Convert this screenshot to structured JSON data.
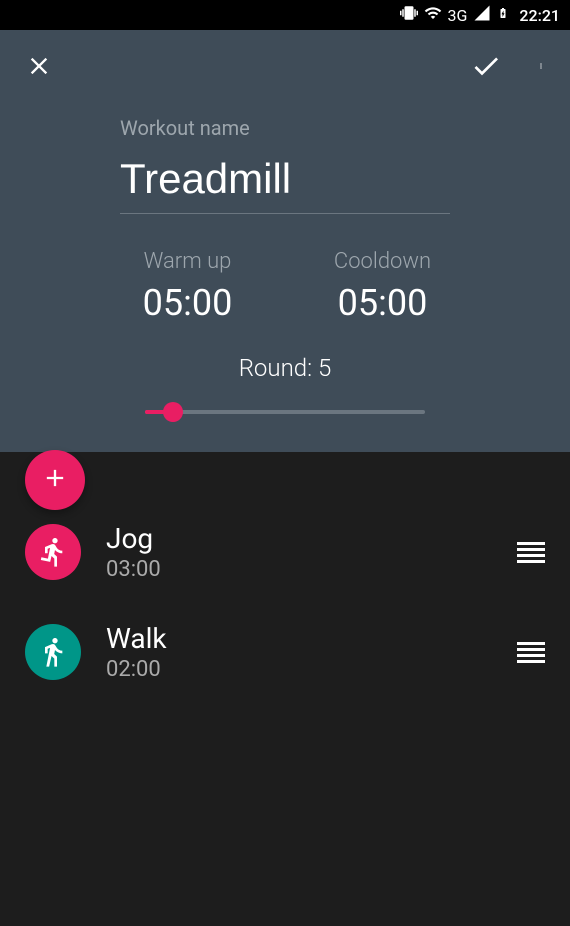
{
  "status": {
    "network": "3G",
    "time": "22:21"
  },
  "form": {
    "name_label": "Workout name",
    "name_value": "Treadmill",
    "warmup_label": "Warm up",
    "warmup_value": "05:00",
    "cooldown_label": "Cooldown",
    "cooldown_value": "05:00",
    "round_label": "Round: 5",
    "round_value": 5,
    "slider_percent": 10
  },
  "exercises": [
    {
      "name": "Jog",
      "duration": "03:00",
      "icon": "run-icon",
      "color": "#e91e63"
    },
    {
      "name": "Walk",
      "duration": "02:00",
      "icon": "walk-icon",
      "color": "#009688"
    }
  ]
}
